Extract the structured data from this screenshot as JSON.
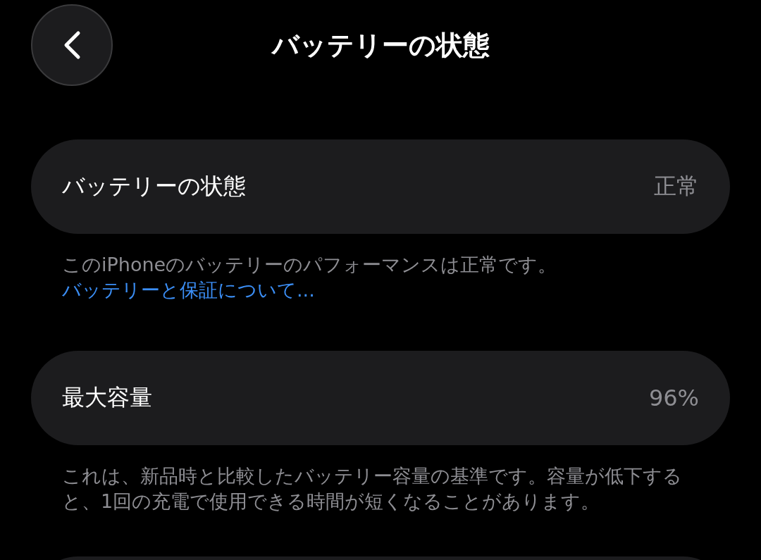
{
  "title": "バッテリーの状態",
  "sections": [
    {
      "label": "バッテリーの状態",
      "value": "正常",
      "note": "このiPhoneのバッテリーのパフォーマンスは正常です。",
      "link": "バッテリーと保証について..."
    },
    {
      "label": "最大容量",
      "value": "96%",
      "note": "これは、新品時と比較したバッテリー容量の基準です。容量が低下すると、1回の充電で使用できる時間が短くなることがあります。"
    }
  ]
}
